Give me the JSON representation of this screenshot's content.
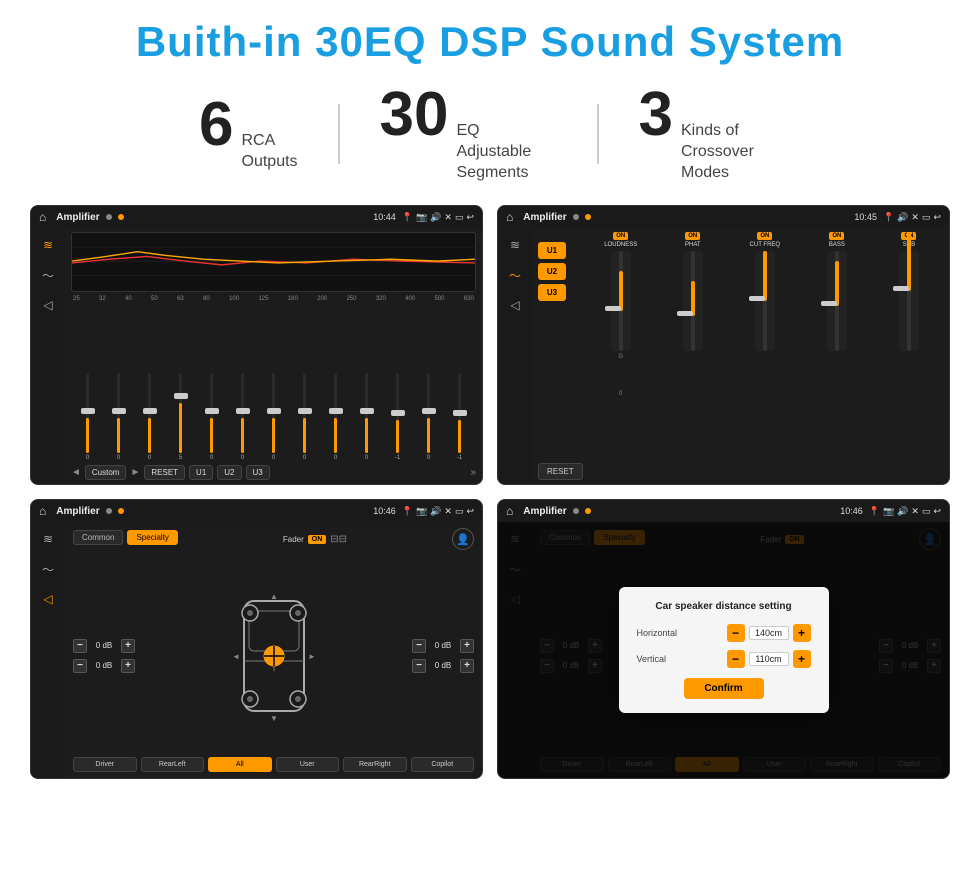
{
  "page": {
    "title": "Buith-in 30EQ DSP Sound System"
  },
  "stats": [
    {
      "number": "6",
      "label": "RCA\nOutputs"
    },
    {
      "number": "30",
      "label": "EQ Adjustable\nSegments"
    },
    {
      "number": "3",
      "label": "Kinds of\nCrossover Modes"
    }
  ],
  "screens": {
    "eq": {
      "appName": "Amplifier",
      "time": "10:44",
      "freqLabels": [
        "25",
        "32",
        "40",
        "50",
        "63",
        "80",
        "100",
        "125",
        "160",
        "200",
        "250",
        "320",
        "400",
        "500",
        "630"
      ],
      "sliderValues": [
        0,
        0,
        0,
        5,
        0,
        0,
        0,
        0,
        0,
        0,
        "-1",
        0,
        "-1"
      ],
      "presetLabel": "Custom",
      "buttons": [
        "◄",
        "Custom",
        "►",
        "RESET",
        "U1",
        "U2",
        "U3"
      ]
    },
    "crossover": {
      "appName": "Amplifier",
      "time": "10:45",
      "presets": [
        "U1",
        "U2",
        "U3"
      ],
      "channels": [
        {
          "name": "LOUDNESS",
          "on": true
        },
        {
          "name": "PHAT",
          "on": true
        },
        {
          "name": "CUT FREQ",
          "on": true
        },
        {
          "name": "BASS",
          "on": true
        },
        {
          "name": "SUB",
          "on": true
        }
      ],
      "resetLabel": "RESET"
    },
    "fader": {
      "appName": "Amplifier",
      "time": "10:46",
      "tabs": [
        "Common",
        "Specialty"
      ],
      "faderLabel": "Fader",
      "faderOn": "ON",
      "dbValues": [
        "0 dB",
        "0 dB",
        "0 dB",
        "0 dB"
      ],
      "buttons": [
        "Driver",
        "RearLeft",
        "All",
        "User",
        "RearRight",
        "Copilot"
      ]
    },
    "dialog": {
      "appName": "Amplifier",
      "time": "10:46",
      "tabs": [
        "Common",
        "Specialty"
      ],
      "title": "Car speaker distance setting",
      "horizontal_label": "Horizontal",
      "horizontal_value": "140cm",
      "vertical_label": "Vertical",
      "vertical_value": "110cm",
      "confirm_label": "Confirm",
      "dbValues": [
        "0 dB",
        "0 dB"
      ],
      "buttons": [
        "Driver",
        "RearLeft",
        "All",
        "User",
        "RearRight",
        "Copilot"
      ]
    }
  }
}
